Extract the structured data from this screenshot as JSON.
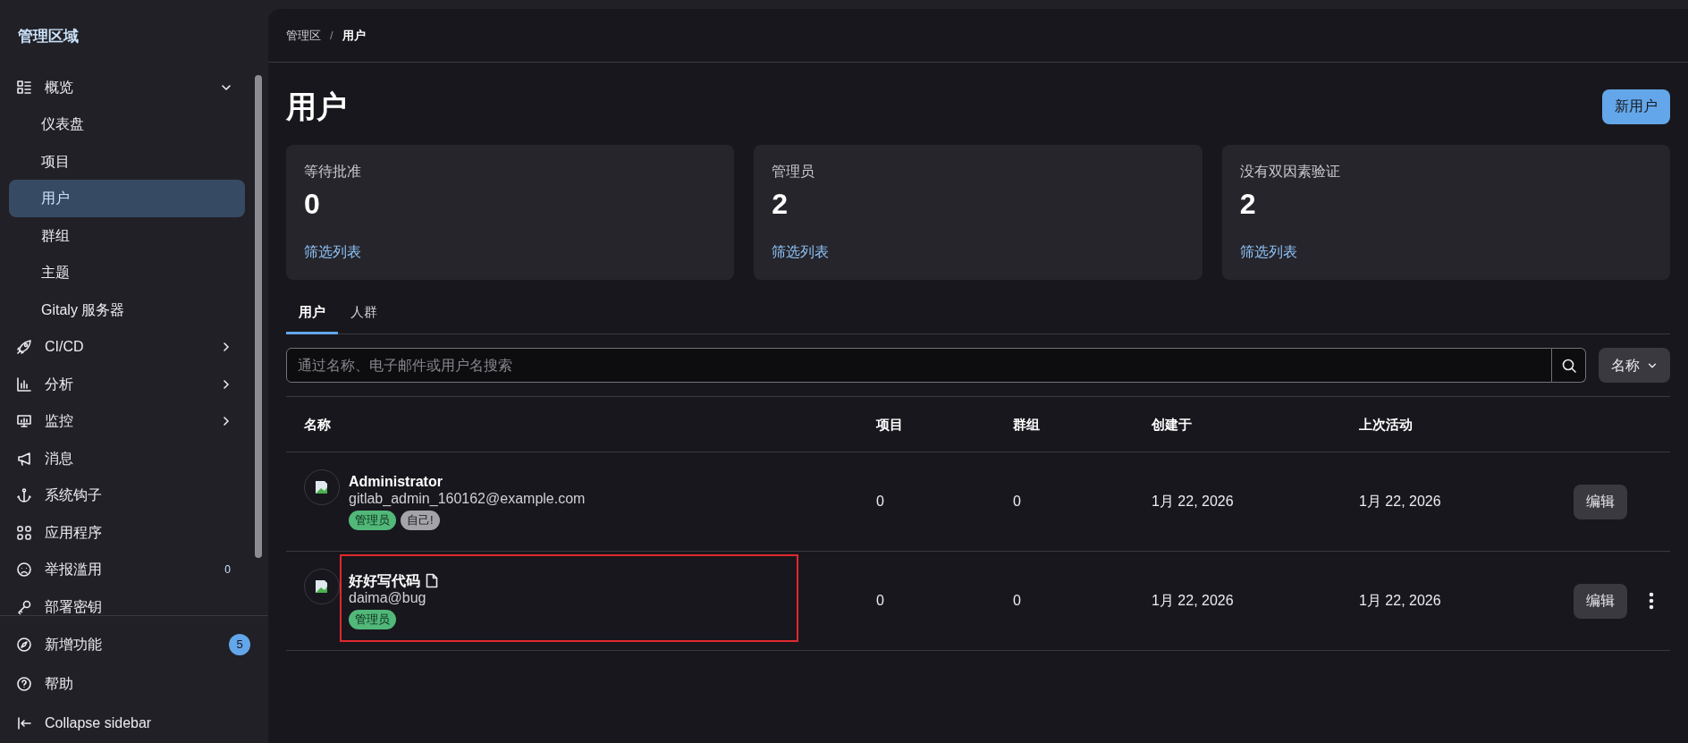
{
  "sidebar": {
    "title": "管理区域",
    "items": [
      {
        "kind": "group",
        "label": "概览",
        "expanded": true,
        "selected": false
      },
      {
        "kind": "child",
        "label": "仪表盘",
        "selected": false
      },
      {
        "kind": "child",
        "label": "项目",
        "selected": false
      },
      {
        "kind": "child",
        "label": "用户",
        "selected": true
      },
      {
        "kind": "child",
        "label": "群组",
        "selected": false
      },
      {
        "kind": "child",
        "label": "主题",
        "selected": false
      },
      {
        "kind": "child",
        "label": "Gitaly 服务器",
        "selected": false
      },
      {
        "kind": "group",
        "label": "CI/CD",
        "expanded": false,
        "selected": false
      },
      {
        "kind": "group",
        "label": "分析",
        "expanded": false,
        "selected": false
      },
      {
        "kind": "group",
        "label": "监控",
        "expanded": false,
        "selected": false
      },
      {
        "kind": "item",
        "label": "消息",
        "selected": false
      },
      {
        "kind": "item",
        "label": "系统钩子",
        "selected": false
      },
      {
        "kind": "item",
        "label": "应用程序",
        "selected": false
      },
      {
        "kind": "item",
        "label": "举报滥用",
        "count": "0",
        "selected": false
      },
      {
        "kind": "item",
        "label": "部署密钥",
        "selected": false
      }
    ],
    "footer": [
      {
        "label": "新增功能",
        "badge": "5"
      },
      {
        "label": "帮助"
      },
      {
        "label": "Collapse sidebar"
      }
    ]
  },
  "breadcrumb_separator": "/",
  "breadcrumb": [
    {
      "label": "管理区",
      "current": false
    },
    {
      "label": "用户",
      "current": true
    }
  ],
  "page_title": "用户",
  "new_button": "新用户",
  "stats": [
    {
      "label": "等待批准",
      "value": "0",
      "link": "筛选列表"
    },
    {
      "label": "管理员",
      "value": "2",
      "link": "筛选列表"
    },
    {
      "label": "没有双因素验证",
      "value": "2",
      "link": "筛选列表"
    }
  ],
  "tabs": [
    {
      "label": "用户",
      "selected": true
    },
    {
      "label": "人群",
      "selected": false
    }
  ],
  "search": {
    "placeholder": "通过名称、电子邮件或用户名搜索"
  },
  "sort_button": "名称",
  "table": {
    "columns": [
      "名称",
      "项目",
      "群组",
      "创建于",
      "上次活动"
    ],
    "rows": [
      {
        "name": "Administrator",
        "email": "gitlab_admin_160162@example.com",
        "badges": [
          {
            "label": "管理员",
            "kind": "admin"
          },
          {
            "label": "自己!",
            "kind": "self"
          }
        ],
        "note_icon": false,
        "highlighted": false,
        "projects": "0",
        "groups": "0",
        "created": "1月 22, 2026",
        "last_activity": "1月 22, 2026",
        "edit": "编辑",
        "more_menu": false
      },
      {
        "name": "好好写代码",
        "email": "daima@bug",
        "badges": [
          {
            "label": "管理员",
            "kind": "admin"
          }
        ],
        "note_icon": true,
        "highlighted": true,
        "projects": "0",
        "groups": "0",
        "created": "1月 22, 2026",
        "last_activity": "1月 22, 2026",
        "edit": "编辑",
        "more_menu": true
      }
    ]
  }
}
